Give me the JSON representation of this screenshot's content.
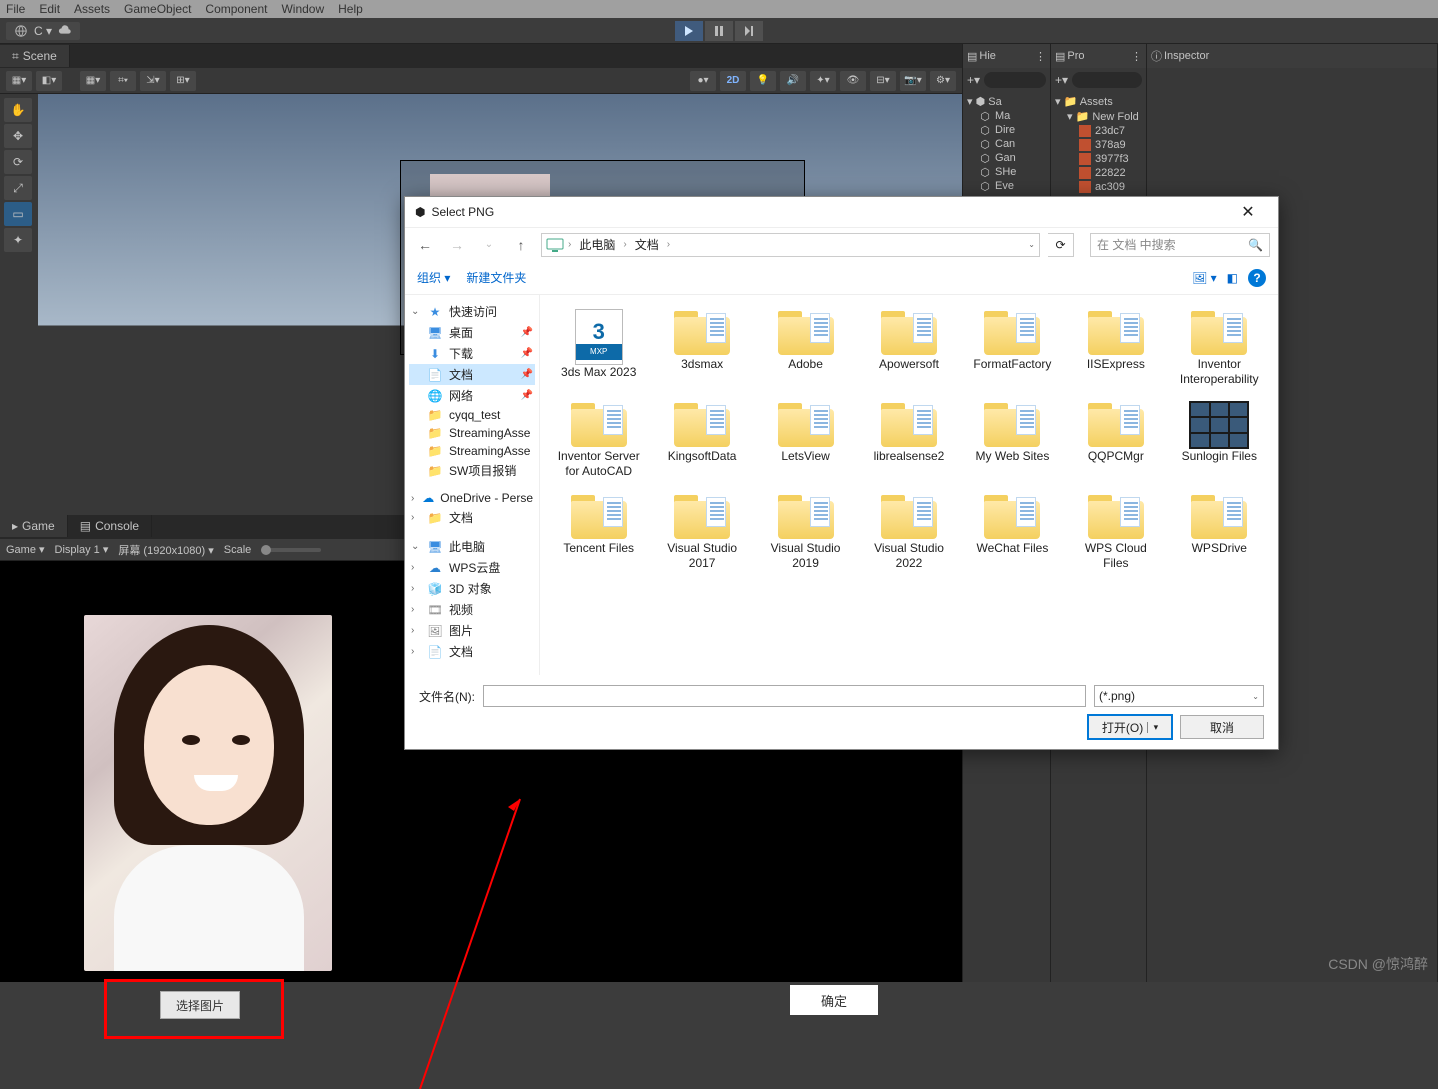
{
  "menubar": [
    "File",
    "Edit",
    "Assets",
    "GameObject",
    "Component",
    "Window",
    "Help"
  ],
  "cloud_label": "C ▾",
  "scene_tab": "Scene",
  "scene_2d": "2D",
  "game_tab": "Game",
  "console_tab": "Console",
  "game_dropdown": "Game",
  "display": "Display 1",
  "resolution": "屏幕 (1920x1080)",
  "scale_label": "Scale",
  "select_img_btn": "选择图片",
  "ok_btn": "确定",
  "hierarchy_tab": "Hie",
  "project_tab": "Pro",
  "inspector_tab": "Inspector",
  "hierarchy_items": [
    "Sa",
    "Ma",
    "Dire",
    "Can",
    "Gan",
    "SHe",
    "Eve"
  ],
  "project_root": "Assets",
  "project_folder": "New Fold",
  "project_items": [
    "23dc7",
    "378a9",
    "3977f3",
    "22822",
    "ac309"
  ],
  "dialog": {
    "title": "Select PNG",
    "path_root": "此电脑",
    "path_crumbs": [
      "文档"
    ],
    "search_placeholder": "在 文档 中搜索",
    "organize": "组织 ▾",
    "newfolder": "新建文件夹",
    "sidebar": {
      "quick": "快速访问",
      "desktop": "桌面",
      "downloads": "下载",
      "documents": "文档",
      "network": "网络",
      "f1": "cyqq_test",
      "f2": "StreamingAsse",
      "f3": "StreamingAsse",
      "f4": "SW项目报销",
      "onedrive": "OneDrive - Perse",
      "od_docs": "文档",
      "thispc": "此电脑",
      "wps": "WPS云盘",
      "threed": "3D 对象",
      "videos": "视频",
      "pictures": "图片",
      "docs2": "文档"
    },
    "files": [
      {
        "name": "3ds Max 2023",
        "type": "mxp"
      },
      {
        "name": "3dsmax",
        "type": "folder"
      },
      {
        "name": "Adobe",
        "type": "folder"
      },
      {
        "name": "Apowersoft",
        "type": "folder"
      },
      {
        "name": "FormatFactory",
        "type": "folder"
      },
      {
        "name": "IISExpress",
        "type": "folder"
      },
      {
        "name": "Inventor Interoperability",
        "type": "folder"
      },
      {
        "name": "Inventor Server for AutoCAD",
        "type": "folder"
      },
      {
        "name": "KingsoftData",
        "type": "folder"
      },
      {
        "name": "LetsView",
        "type": "folder"
      },
      {
        "name": "librealsense2",
        "type": "folder"
      },
      {
        "name": "My Web Sites",
        "type": "folder"
      },
      {
        "name": "QQPCMgr",
        "type": "folder"
      },
      {
        "name": "Sunlogin Files",
        "type": "dark"
      },
      {
        "name": "Tencent Files",
        "type": "folder"
      },
      {
        "name": "Visual Studio 2017",
        "type": "folder"
      },
      {
        "name": "Visual Studio 2019",
        "type": "folder"
      },
      {
        "name": "Visual Studio 2022",
        "type": "folder"
      },
      {
        "name": "WeChat Files",
        "type": "folder"
      },
      {
        "name": "WPS Cloud Files",
        "type": "folder"
      },
      {
        "name": "WPSDrive",
        "type": "folder"
      }
    ],
    "filename_label": "文件名(N):",
    "filter": "(*.png)",
    "open_btn": "打开(O)",
    "cancel_btn": "取消"
  },
  "watermark": "CSDN @惊鸿醉"
}
